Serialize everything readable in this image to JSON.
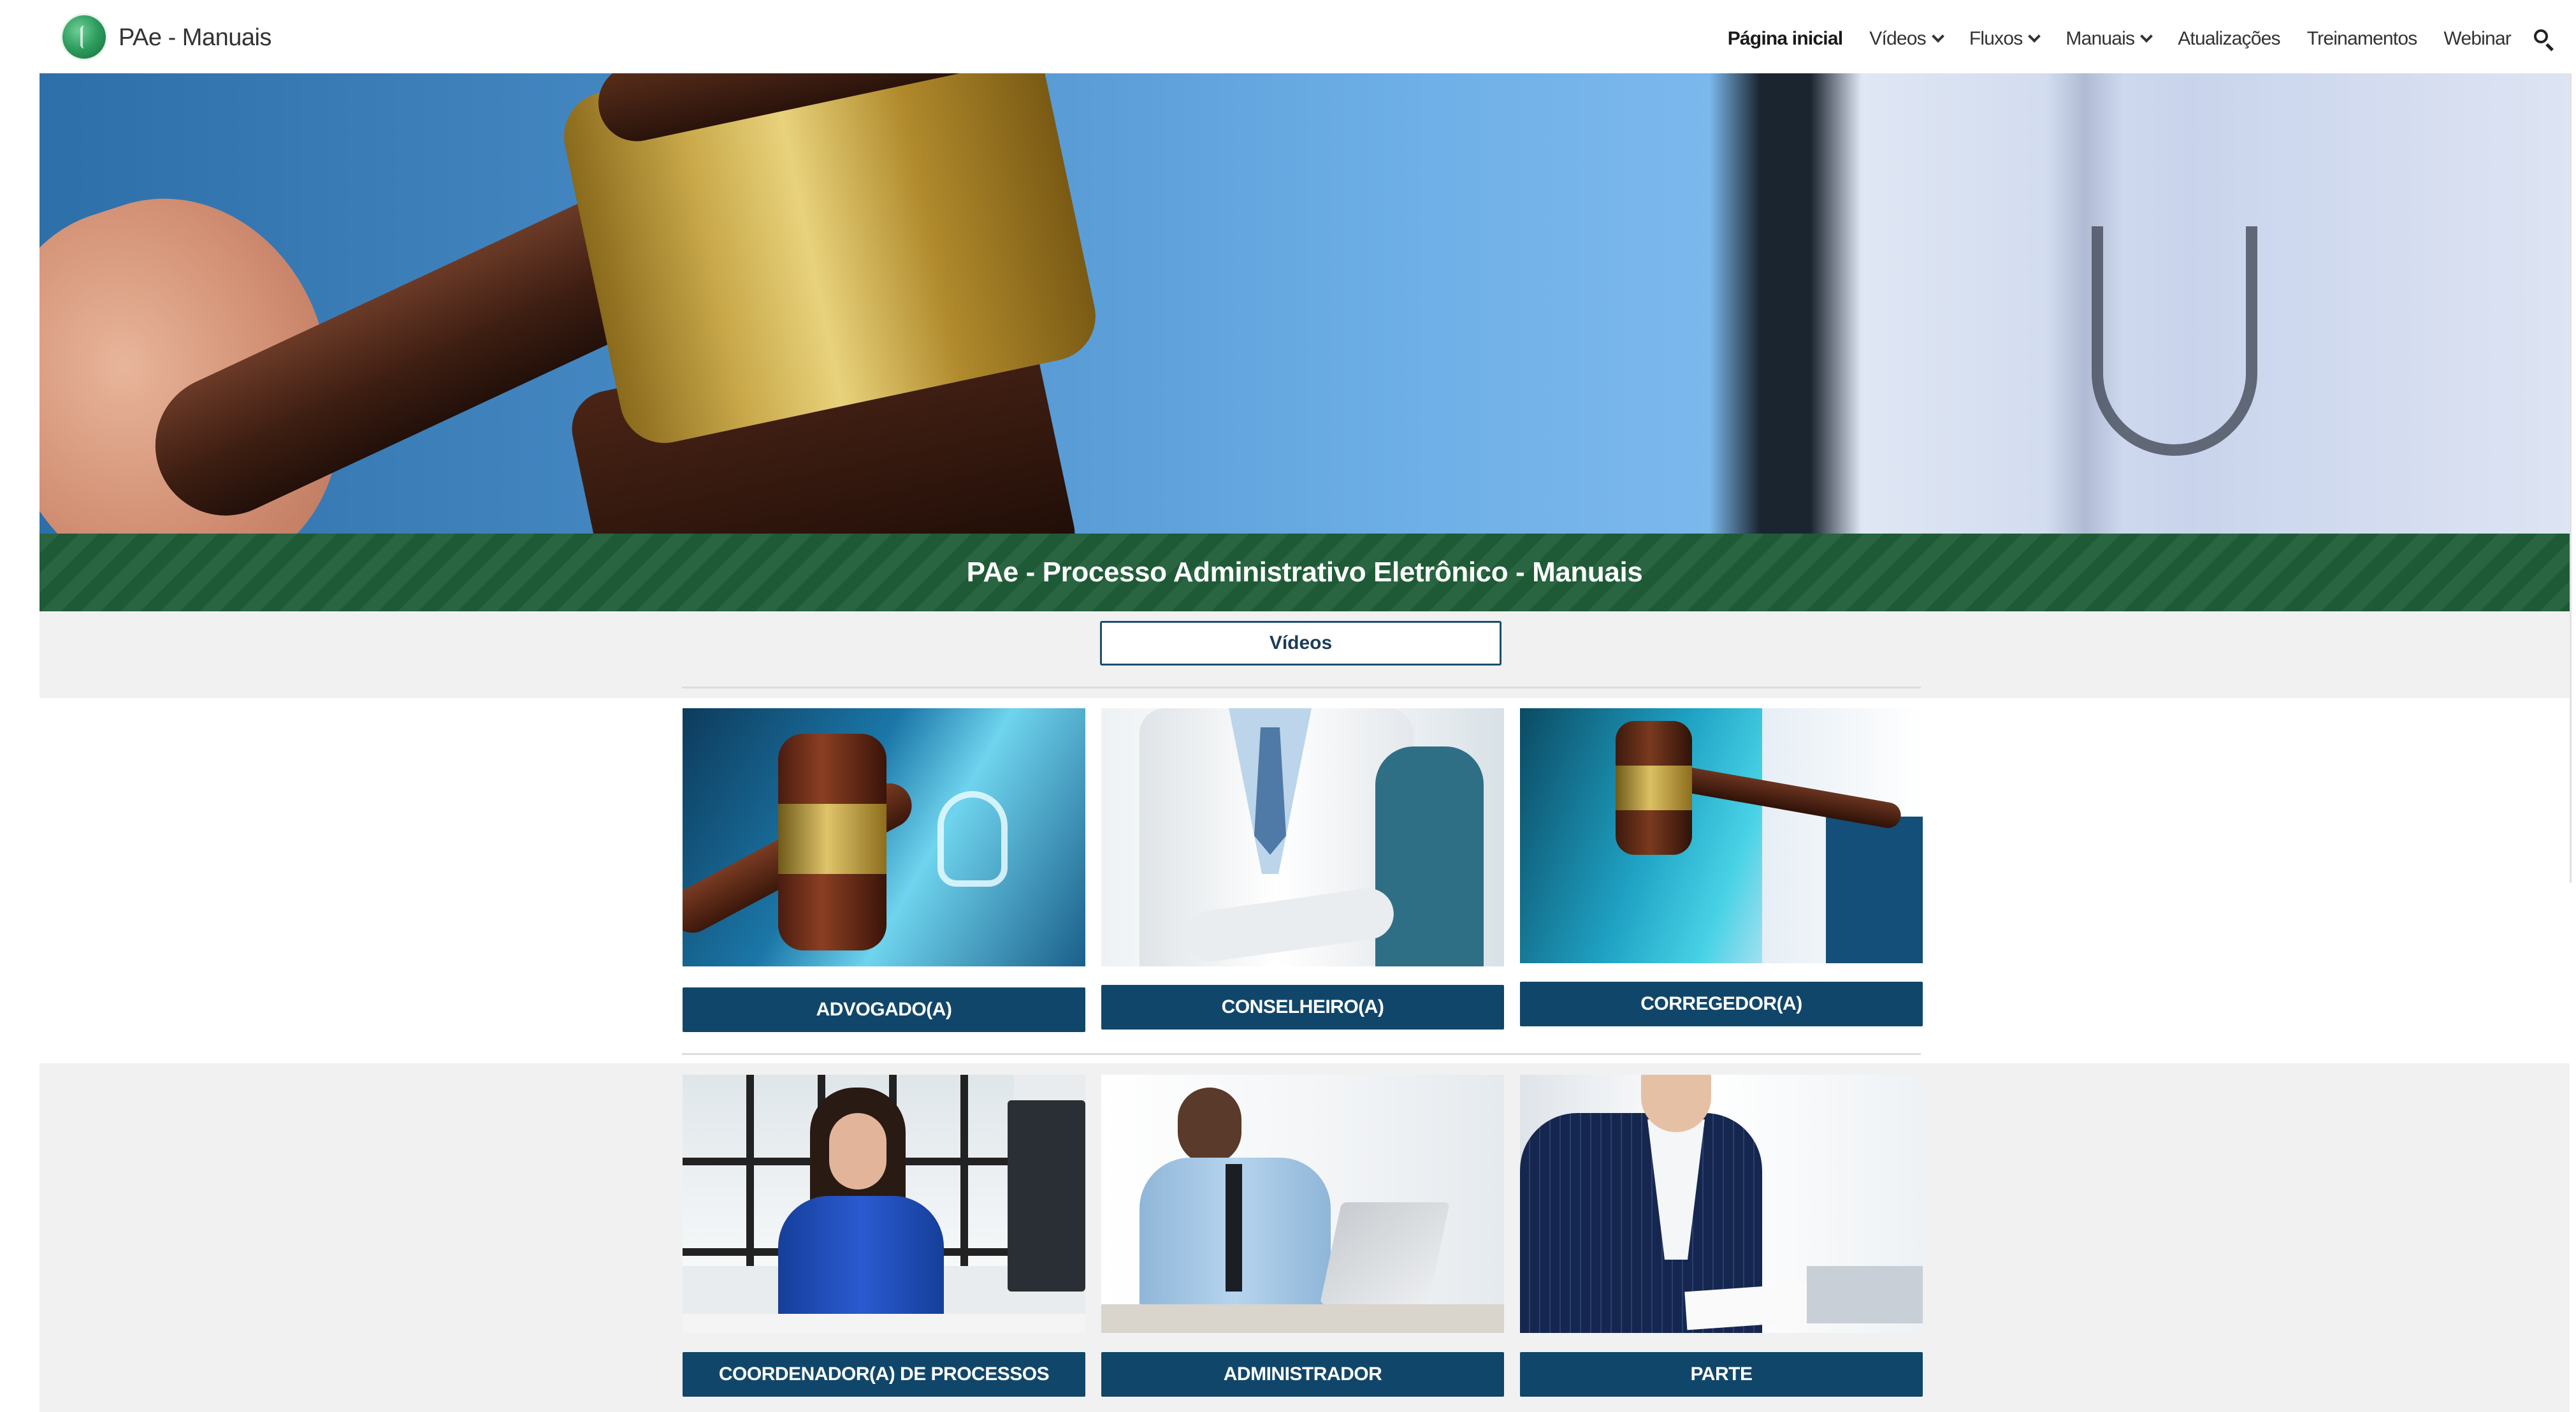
{
  "header": {
    "site_title": "PAe - Manuais",
    "nav": [
      {
        "label": "Página inicial",
        "active": true,
        "dropdown": false
      },
      {
        "label": "Vídeos",
        "active": false,
        "dropdown": true
      },
      {
        "label": "Fluxos",
        "active": false,
        "dropdown": true
      },
      {
        "label": "Manuais",
        "active": false,
        "dropdown": true
      },
      {
        "label": "Atualizações",
        "active": false,
        "dropdown": false
      },
      {
        "label": "Treinamentos",
        "active": false,
        "dropdown": false
      },
      {
        "label": "Webinar",
        "active": false,
        "dropdown": false
      }
    ],
    "search_icon": "search-icon"
  },
  "band": {
    "title": "PAe - Processo Administrativo Eletrônico - Manuais"
  },
  "videos_button": "Vídeos",
  "cards": [
    {
      "label": "ADVOGADO(A)"
    },
    {
      "label": "CONSELHEIRO(A)"
    },
    {
      "label": "CORREGEDOR(A)"
    },
    {
      "label": "COORDENADOR(A) DE PROCESSOS"
    },
    {
      "label": "ADMINISTRADOR"
    },
    {
      "label": "PARTE"
    }
  ],
  "colors": {
    "band_green": "#1f5f38",
    "button_navy": "#11466b",
    "section_grey": "#f1f1f1"
  }
}
